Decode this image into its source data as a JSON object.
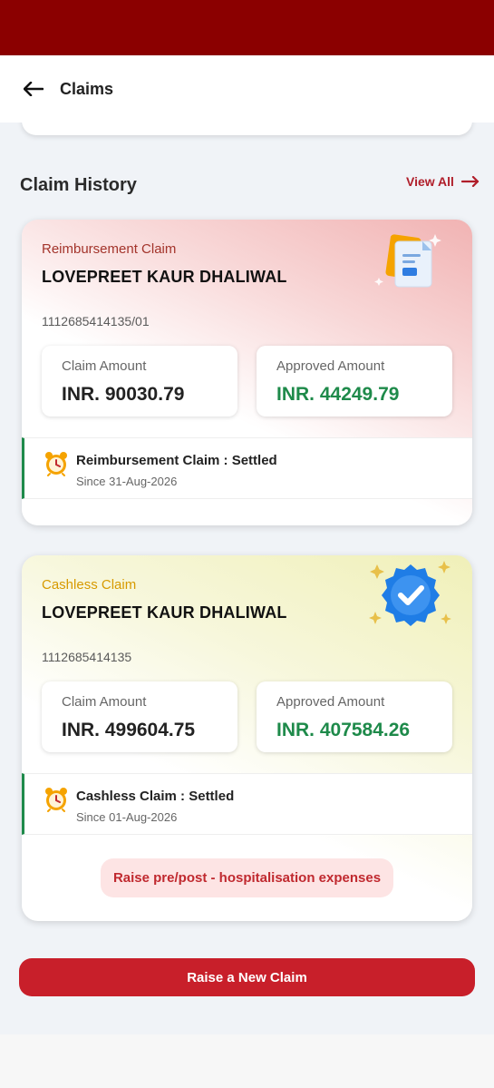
{
  "header": {
    "title": "Claims"
  },
  "section": {
    "title": "Claim History",
    "view_all": "View All"
  },
  "claims": [
    {
      "type": "Reimbursement Claim",
      "name": "LOVEPREET KAUR DHALIWAL",
      "number": "1112685414135/01",
      "claim_amount_label": "Claim Amount",
      "claim_amount": "INR. 90030.79",
      "approved_amount_label": "Approved Amount",
      "approved_amount": "INR. 44249.79",
      "status": "Reimbursement Claim : Settled",
      "since": "Since 31-Aug-2026",
      "icon": "document-icon"
    },
    {
      "type": "Cashless Claim",
      "name": "LOVEPREET KAUR DHALIWAL",
      "number": "1112685414135",
      "claim_amount_label": "Claim Amount",
      "claim_amount": "INR. 499604.75",
      "approved_amount_label": "Approved Amount",
      "approved_amount": "INR. 407584.26",
      "status": "Cashless Claim : Settled",
      "since": "Since 01-Aug-2026",
      "icon": "verified-badge-icon",
      "action_label": "Raise pre/post - hospitalisation expenses"
    }
  ],
  "footer": {
    "raise_button": "Raise a New Claim"
  },
  "colors": {
    "brand_dark": "#8b0000",
    "primary": "#c81f2a",
    "approved": "#1e8a4a",
    "cashless": "#d79a00"
  }
}
